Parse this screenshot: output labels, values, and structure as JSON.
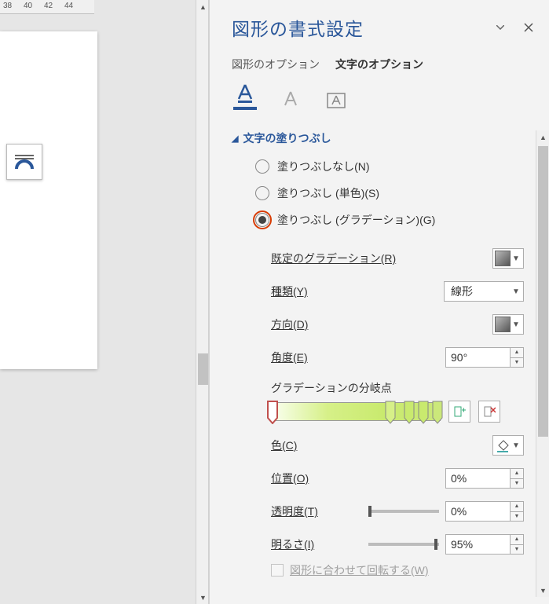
{
  "ruler": {
    "m38": "38",
    "m40": "40",
    "m42": "42",
    "m44": "44"
  },
  "panel": {
    "title": "図形の書式設定",
    "tabs": {
      "shape": "図形のオプション",
      "text": "文字のオプション"
    }
  },
  "section": {
    "title": "文字の塗りつぶし",
    "radios": {
      "none": "塗りつぶしなし(N)",
      "solid": "塗りつぶし (単色)(S)",
      "gradient": "塗りつぶし (グラデーション)(G)"
    }
  },
  "controls": {
    "preset": "既定のグラデーション(R)",
    "type_label": "種類(Y)",
    "type_value": "線形",
    "direction": "方向(D)",
    "angle_label": "角度(E)",
    "angle_value": "90°",
    "stops_label": "グラデーションの分岐点",
    "color_label": "色(C)",
    "position_label": "位置(O)",
    "position_value": "0%",
    "transparency_label": "透明度(T)",
    "transparency_value": "0%",
    "brightness_label": "明るさ(I)",
    "brightness_value": "95%",
    "rotate_label": "図形に合わせて回転する(W)"
  }
}
